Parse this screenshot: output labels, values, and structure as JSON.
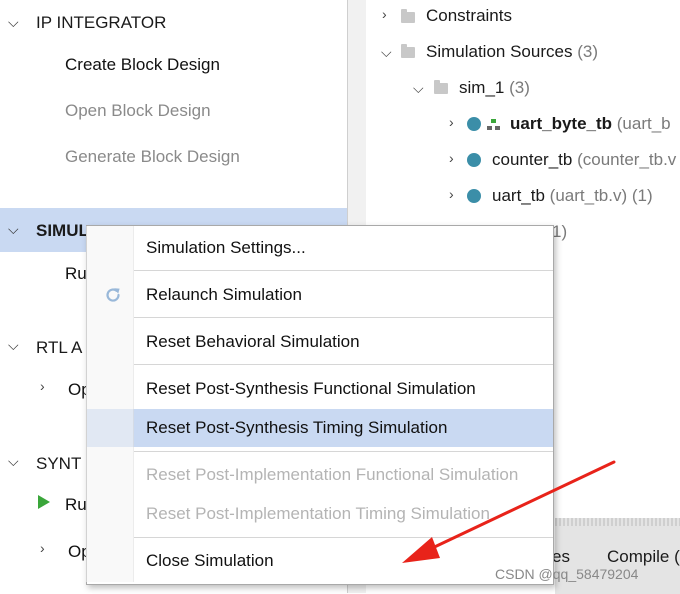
{
  "left_nav": {
    "ip_integrator": {
      "title": "IP INTEGRATOR",
      "items": [
        "Create Block Design",
        "Open Block Design",
        "Generate Block Design"
      ]
    },
    "simulation": {
      "title_partial": "SIMUL",
      "run_partial": "Ru"
    },
    "rtl_analysis": {
      "title_partial": "RTL A",
      "open_partial": "Op"
    },
    "synthesis": {
      "title_partial": "SYNT",
      "run_partial": "Ru",
      "open_partial": "Op"
    }
  },
  "sources": {
    "constraints": "Constraints",
    "sim_sources": "Simulation Sources",
    "sim_sources_count": "(3)",
    "sim_1": "sim_1",
    "sim_1_count": "(3)",
    "files": [
      {
        "name": "uart_byte_tb",
        "detail": "(uart_b"
      },
      {
        "name": "counter_tb",
        "detail": "(counter_tb.v"
      },
      {
        "name": "uart_tb",
        "detail": "(uart_tb.v) (1)"
      }
    ],
    "hidden_count": "1)",
    "tabs_partial": [
      "es",
      "Compile ("
    ]
  },
  "context_menu": {
    "items": [
      {
        "label": "Simulation Settings...",
        "disabled": false
      },
      {
        "label": "Relaunch Simulation",
        "disabled": false,
        "icon": "refresh-icon"
      },
      {
        "label": "Reset Behavioral Simulation",
        "disabled": false
      },
      {
        "label": "Reset Post-Synthesis Functional Simulation",
        "disabled": false
      },
      {
        "label": "Reset Post-Synthesis Timing Simulation",
        "disabled": false,
        "highlighted": true
      },
      {
        "label": "Reset Post-Implementation Functional Simulation",
        "disabled": true
      },
      {
        "label": "Reset Post-Implementation Timing Simulation",
        "disabled": true
      },
      {
        "label": "Close Simulation",
        "disabled": false
      }
    ]
  },
  "watermark": "CSDN @qq_58479204",
  "colors": {
    "highlight": "#c9d9f2",
    "arrow": "#e8231a",
    "run_triangle": "#3aa63a",
    "file_dot": "#3b8ea8"
  }
}
